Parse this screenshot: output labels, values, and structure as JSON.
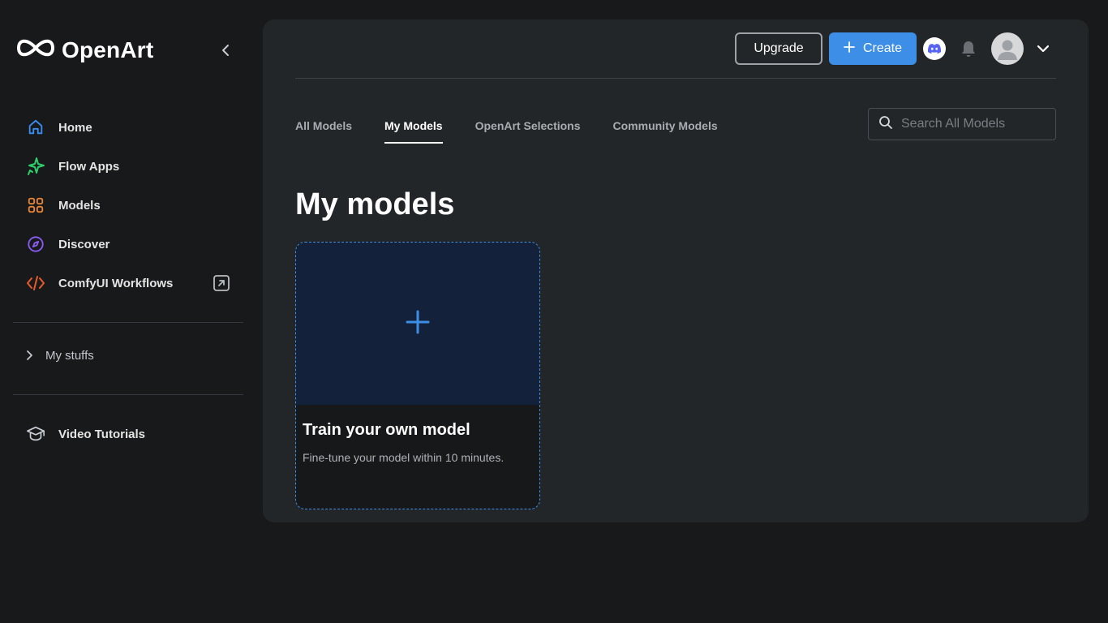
{
  "brand": {
    "name": "OpenArt"
  },
  "sidebar": {
    "items": [
      {
        "label": "Home",
        "icon": "home-icon",
        "color": "#3b8ef0"
      },
      {
        "label": "Flow Apps",
        "icon": "sparkle-icon",
        "color": "#2fcf6b"
      },
      {
        "label": "Models",
        "icon": "grid-icon",
        "color": "#e88434"
      },
      {
        "label": "Discover",
        "icon": "compass-icon",
        "color": "#8b5cf6"
      },
      {
        "label": "ComfyUI Workflows",
        "icon": "code-icon",
        "color": "#ea5a2a"
      }
    ],
    "my_stuffs_label": "My stuffs",
    "tutorials_label": "Video Tutorials"
  },
  "header": {
    "upgrade_label": "Upgrade",
    "create_label": "Create"
  },
  "tabs": [
    {
      "label": "All Models",
      "active": false
    },
    {
      "label": "My Models",
      "active": true
    },
    {
      "label": "OpenArt Selections",
      "active": false
    },
    {
      "label": "Community Models",
      "active": false
    }
  ],
  "search": {
    "placeholder": "Search All Models",
    "value": ""
  },
  "main": {
    "title": "My models",
    "train_card": {
      "title": "Train your own model",
      "description": "Fine-tune your model within 10 minutes."
    }
  },
  "colors": {
    "accent": "#3c8ee6",
    "discord": "#5865f2",
    "background": "#17191b",
    "panel": "#232628"
  }
}
